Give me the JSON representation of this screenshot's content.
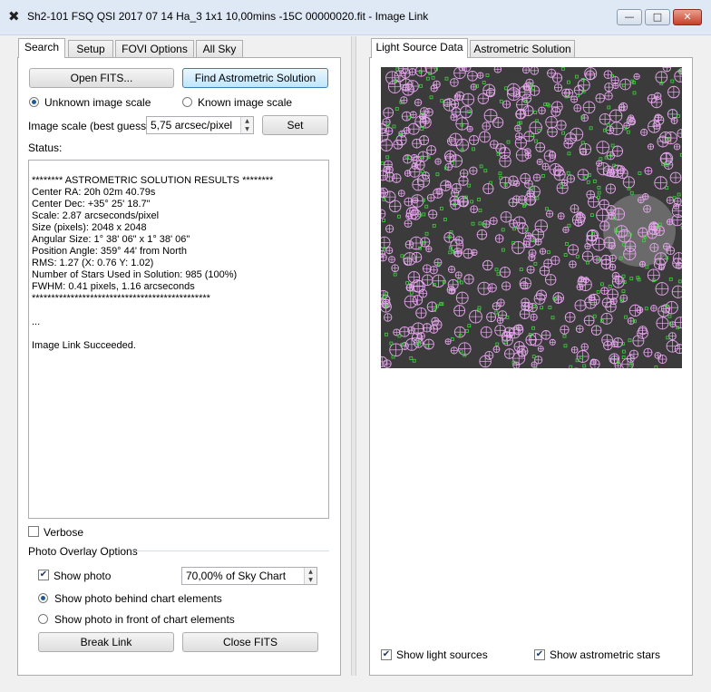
{
  "window": {
    "title": "Sh2-101 FSQ QSI 2017 07 14  Ha_3 1x1 10,00mins -15C 00000020.fit - Image Link",
    "minimize": "—",
    "maximize": "□",
    "close": "✕",
    "icon": "x-logo-icon"
  },
  "left_tabs": [
    "Search",
    "Setup",
    "FOVI Options",
    "All Sky"
  ],
  "buttons": {
    "open_fits": "Open FITS...",
    "find_solution": "Find Astrometric Solution",
    "set": "Set",
    "break_link": "Break Link",
    "close_fits": "Close FITS"
  },
  "scale": {
    "unknown_label": "Unknown image scale",
    "known_label": "Known image scale",
    "best_guess_label": "Image scale (best guess):",
    "best_guess_value": "5,75 arcsec/pixel",
    "selected": "unknown"
  },
  "status": {
    "label": "Status:",
    "lines": [
      "******** ASTROMETRIC SOLUTION RESULTS ********",
      "Center RA: 20h 02m 40.79s",
      "Center Dec: +35° 25' 18.7\"",
      "Scale: 2.87 arcseconds/pixel",
      "Size (pixels): 2048 x 2048",
      "Angular Size: 1° 38' 06\" x 1° 38' 06\"",
      "Position Angle: 359° 44' from North",
      "RMS: 1.27 (X: 0.76 Y: 1.02)",
      "Number of Stars Used in Solution: 985 (100%)",
      "FWHM: 0.41 pixels, 1.16 arcseconds",
      "**********************************************",
      "",
      "...",
      "",
      "Image Link Succeeded."
    ]
  },
  "verbose": {
    "label": "Verbose",
    "checked": false
  },
  "overlay": {
    "group_label": "Photo Overlay Options",
    "show_photo_label": "Show photo",
    "show_photo_checked": true,
    "opacity_value": "70,00% of Sky Chart",
    "behind_label": "Show photo behind chart elements",
    "front_label": "Show photo in front of chart elements",
    "selected": "behind"
  },
  "right_tabs": [
    "Light Source Data",
    "Astrometric Solution"
  ],
  "right": {
    "show_light_sources": "Show light sources",
    "show_astrometric_stars": "Show astrometric stars",
    "light_checked": true,
    "astro_checked": true
  },
  "colors": {
    "light_source_marker": "#e9a6f0",
    "astrometric_marker": "#3fd33f",
    "sky_background": "#3b3b3b"
  }
}
